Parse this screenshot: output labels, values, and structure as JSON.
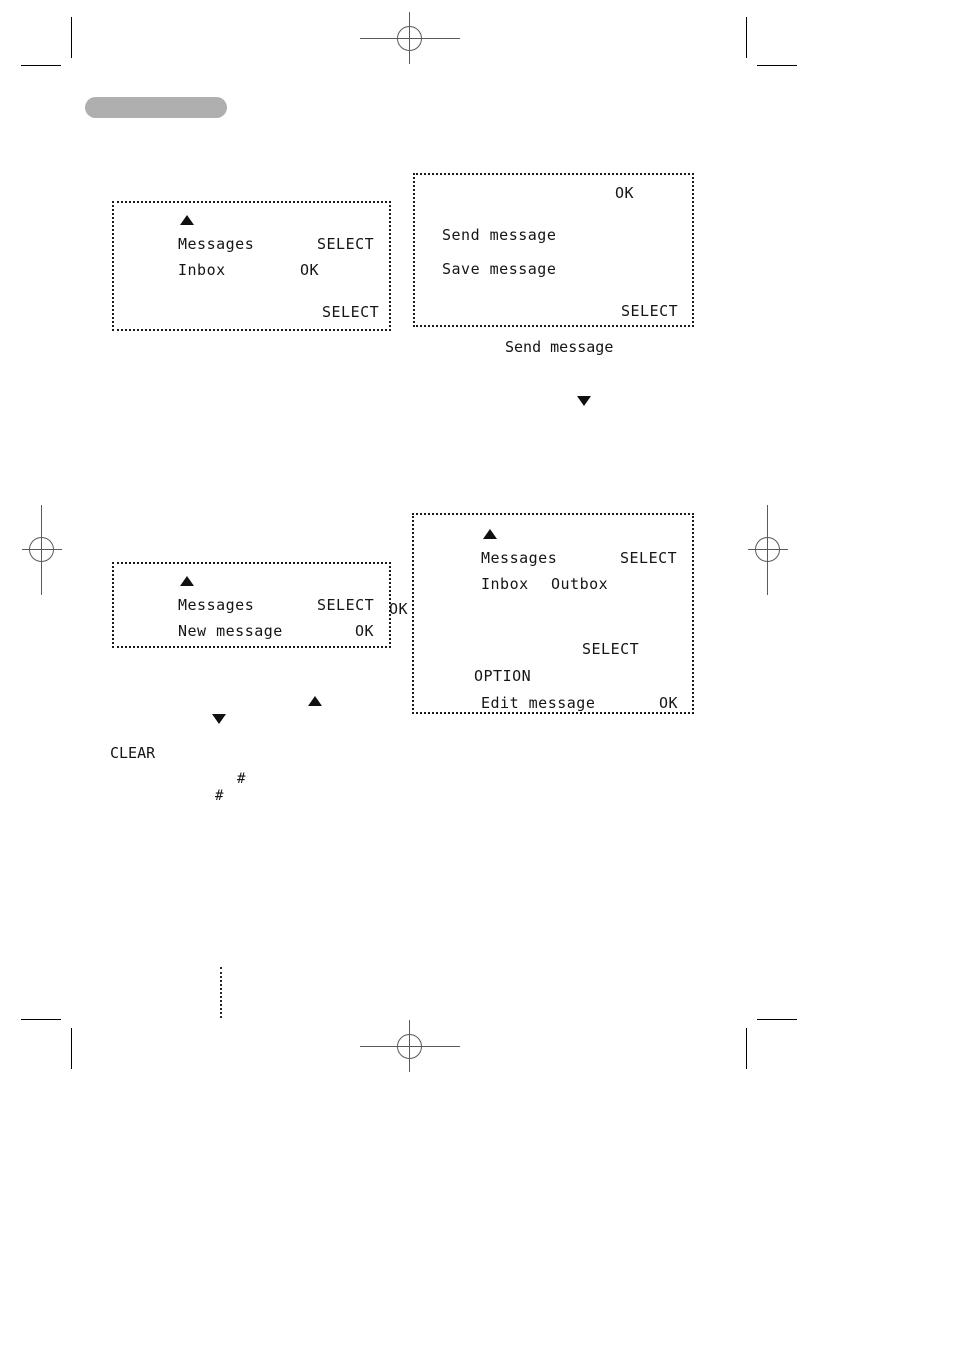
{
  "page": {
    "background_color": "#ffffff",
    "accent_gray": "#afafaf",
    "ink_color": "#151515",
    "regmark_color": "#5a5a5a"
  },
  "header": {
    "pill_label": ""
  },
  "screens": {
    "messages_inbox": {
      "name": "Messages / Inbox screen",
      "indicator_arrow": "up-arrow",
      "rows": [
        {
          "left": "Messages",
          "right": "SELECT"
        },
        {
          "left": "Inbox",
          "right": "OK"
        }
      ],
      "footer_softkey": "SELECT"
    },
    "send_save_message": {
      "name": "Send / Save message screen",
      "header_softkey": "OK",
      "rows": [
        {
          "left": "Send message",
          "right": ""
        },
        {
          "left": "Save message",
          "right": ""
        }
      ],
      "footer_softkey": "SELECT",
      "caption": "Send message"
    },
    "messages_new_message": {
      "name": "Messages / New message screen",
      "indicator_arrow": "up-arrow",
      "rows": [
        {
          "left": "Messages",
          "right": "SELECT"
        },
        {
          "left": "New message",
          "right": "OK"
        }
      ]
    },
    "messages_outbox_edit": {
      "name": "Messages / Inbox / Outbox / Edit message screen",
      "indicator_arrow": "up-arrow",
      "rows": [
        {
          "left": "Messages",
          "right": "SELECT"
        },
        {
          "left": "Inbox",
          "mid": "Outbox",
          "right": ""
        }
      ],
      "edge_softkey_ok": "OK",
      "softkey_select": "SELECT",
      "option_label": "OPTION",
      "last_row": {
        "left": "Edit message",
        "right": "OK"
      }
    }
  },
  "annotations": {
    "arrow_down_mid": "down-arrow",
    "arrow_down_lower": "down-arrow",
    "arrow_up_lower": "up-arrow",
    "clear_label": "CLEAR",
    "hash_key_1": "#",
    "hash_key_2": "#"
  }
}
